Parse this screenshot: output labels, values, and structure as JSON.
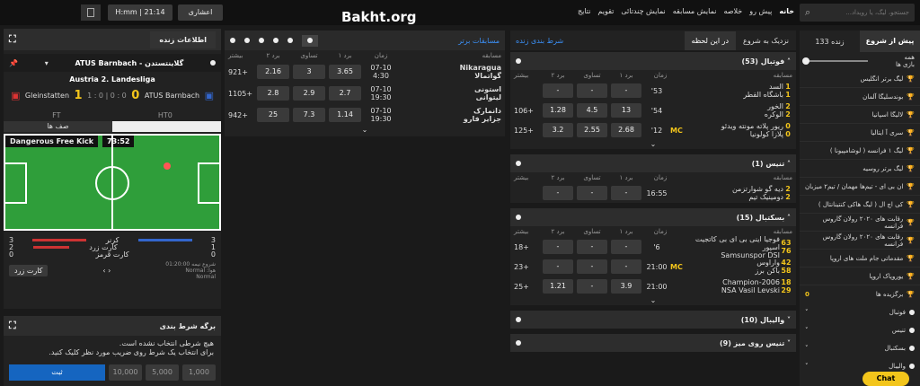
{
  "topbar": {
    "search_placeholder": "جستجو، لیگ، یا رویداد...",
    "nav": [
      "خانه",
      "پیش رو",
      "خلاصه",
      "نمایش مسابقه",
      "نمایش چندتائی",
      "تقویم",
      "نتایج"
    ],
    "odds_format": "اعشاری",
    "time": "H:mm | 21:14",
    "watermark": "Bakht.org"
  },
  "left_panel": {
    "tab_live": "اطلاعات زنده",
    "match_title": "ATUS Barnbach - گلاینتستدن",
    "league": "Austria 2. Landesliga",
    "home": "Gleinstatten",
    "away": "ATUS Barnbach",
    "score_home": "1",
    "score_away": "0",
    "ht_score": "1 : 0 | 0 : 0",
    "ft": "FT",
    "ht": "HT0",
    "lineups": "صف ها",
    "field_event": "Dangerous Free Kick",
    "field_time": "73:52",
    "stats": [
      {
        "label": "کرنر",
        "home": "3",
        "away": "3"
      },
      {
        "label": "کارت زرد",
        "home": "2",
        "away": "1"
      },
      {
        "label": "کارت قرمز",
        "home": "0",
        "away": "0"
      }
    ],
    "stat_meta": [
      "01:20:00 شروع نیمه",
      "Normal :هوا",
      "Normal"
    ],
    "yellow_card_btn": "کارت زرد"
  },
  "betslip": {
    "title": "برگه شرط بندی",
    "msg1": "هیچ شرطی انتخاب نشده است.",
    "msg2": "برای انتخاب یک شرط روی ضریب مورد نظر کلیک کنید.",
    "stakes": [
      "1,000",
      "5,000",
      "10,000"
    ],
    "place_btn": "ثبت"
  },
  "top_matches": {
    "title": "مسابقات برتر",
    "columns": [
      "مسابقه",
      "زمان",
      "برد ۱",
      "تساوی",
      "برد ۲",
      "بیشتر"
    ],
    "rows": [
      {
        "team1": "Nikaragua",
        "team2": "گواتمالا",
        "date": "07-10",
        "time": "4:30",
        "o1": "3.65",
        "ox": "3",
        "o2": "2.16",
        "more": "921+"
      },
      {
        "team1": "استونی",
        "team2": "لیتوانی",
        "date": "07-10",
        "time": "19:30",
        "o1": "2.7",
        "ox": "2.9",
        "o2": "2.8",
        "more": "1105+"
      },
      {
        "team1": "دانمارک",
        "team2": "جزایر فارو",
        "date": "07-10",
        "time": "19:30",
        "o1": "1.14",
        "ox": "7.3",
        "o2": "25",
        "more": "942+"
      }
    ]
  },
  "live_panel": {
    "tab1": "شرط بندی زنده",
    "tab2": "در این لحظه",
    "tab3": "نزدیک به شروع",
    "columns": [
      "مسابقه",
      "زمان",
      "برد ۱",
      "تساوی",
      "برد ۲",
      "بیشتر"
    ],
    "sections": [
      {
        "name": "فوتبال",
        "count": "(53)",
        "rows": [
          {
            "t1": "السد",
            "t2": "باشگاه القطر",
            "s1": "1",
            "s2": "1",
            "time": "'53",
            "o1": "-",
            "ox": "-",
            "o2": "-",
            "more": "",
            "mc": ""
          },
          {
            "t1": "الخور",
            "t2": "الوکره",
            "s1": "2",
            "s2": "2",
            "time": "'54",
            "o1": "13",
            "ox": "4.5",
            "o2": "1.28",
            "more": "106+",
            "mc": ""
          },
          {
            "t1": "ریور پلاته مونته ویدئو",
            "t2": "پلازا کولونیا",
            "s1": "0",
            "s2": "0",
            "time": "'12",
            "o1": "2.68",
            "ox": "2.55",
            "o2": "3.2",
            "more": "125+",
            "mc": "MC"
          }
        ]
      },
      {
        "name": "تنیس",
        "count": "(1)",
        "rows": [
          {
            "t1": "دیه گو شوارتزمن",
            "t2": "دومینیک تیم",
            "s1": "2",
            "s2": "2",
            "time": "16:55",
            "o1": "-",
            "ox": "-",
            "o2": "-",
            "more": "",
            "mc": ""
          }
        ]
      },
      {
        "name": "بسکتبال",
        "count": "(15)",
        "rows": [
          {
            "t1": "فوجیا اینی بی ای بی کاتجیت اسپور",
            "t2": "Samsunspor DSI",
            "s1": "63",
            "s2": "76",
            "time": "'6",
            "o1": "-",
            "ox": "-",
            "o2": "-",
            "more": "18+",
            "mc": ""
          },
          {
            "t1": "واراوس",
            "t2": "باکن برز",
            "s1": "42",
            "s2": "58",
            "time": "21:00",
            "o1": "-",
            "ox": "-",
            "o2": "-",
            "more": "23+",
            "mc": "MC"
          },
          {
            "t1": "Champion-2006",
            "t2": "NSA Vasil Levski",
            "s1": "18",
            "s2": "29",
            "time": "21:00",
            "o1": "3.9",
            "ox": "-",
            "o2": "1.21",
            "more": "25+",
            "mc": ""
          }
        ]
      },
      {
        "name": "والیبال",
        "count": "(10)",
        "rows": []
      },
      {
        "name": "تنیس روی میز",
        "count": "(9)",
        "rows": []
      }
    ]
  },
  "right_sidebar": {
    "tab_pre": "پیش از شروع",
    "tab_live": "زنده",
    "live_count": "133",
    "all_label": "همه",
    "all_sub": "بازی ها",
    "leagues": [
      "لیگ برتر انگلیس",
      "بوندسلیگا آلمان",
      "لالیگا اسپانیا",
      "سری آ ایتالیا",
      "لیگ ۱ فرانسه ( لوشامپیونا )",
      "لیگ برتر روسیه",
      "ان بی ای - تیم‌ها مهمان / تیم۲ میزبان",
      "کی اچ ال ( لیگ هاکی کنتینانتال )",
      "رقابت های ۲۰۲۰ رولان گاروس فرانسه",
      "رقابت های ۲۰۲۰ رولان گاروس فرانسه",
      "مقدماتی جام ملت های اروپا",
      "یوروپاک اروپا"
    ],
    "highlights": "برگزیده ها",
    "highlights_count": "0",
    "sports": [
      "فوتبال",
      "تنیس",
      "بسکتبال",
      "والیبال"
    ],
    "chat": "Chat"
  }
}
